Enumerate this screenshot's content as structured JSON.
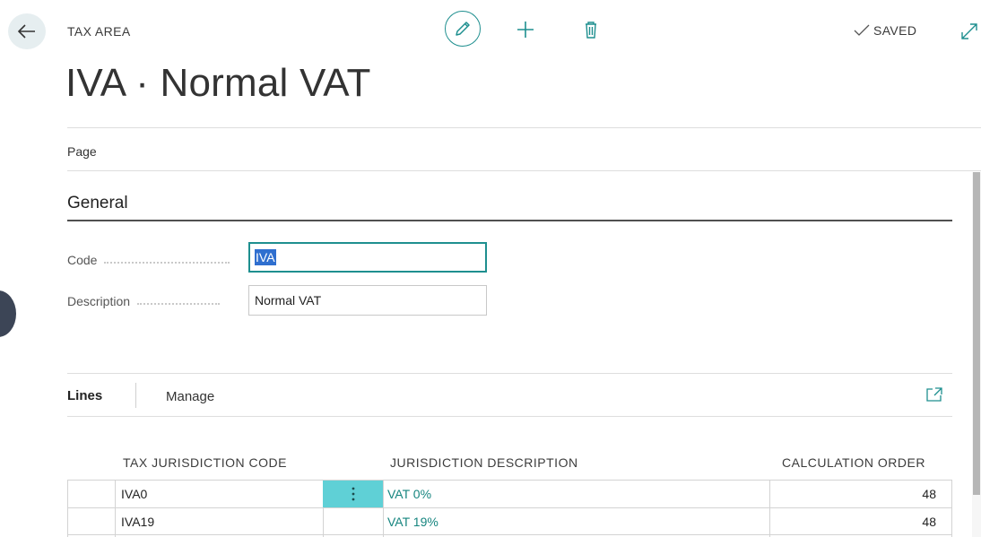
{
  "header": {
    "breadcrumb": "TAX AREA",
    "title": "IVA · Normal VAT",
    "status": "SAVED"
  },
  "action_bar": {
    "page_tab": "Page"
  },
  "general": {
    "title": "General",
    "fields": [
      {
        "label": "Code",
        "value": "IVA",
        "selected": true
      },
      {
        "label": "Description",
        "value": "Normal VAT"
      }
    ]
  },
  "lines": {
    "title": "Lines",
    "manage": "Manage",
    "columns": [
      "TAX JURISDICTION CODE",
      "JURISDICTION DESCRIPTION",
      "CALCULATION ORDER"
    ],
    "rows": [
      {
        "code": "IVA0",
        "description": "VAT 0%",
        "order": "48"
      },
      {
        "code": "IVA19",
        "description": "VAT 19%",
        "order": "48"
      }
    ]
  },
  "icons": {
    "back": "arrow-left-icon",
    "edit": "pencil-icon",
    "add": "plus-icon",
    "delete": "trash-icon",
    "saved": "checkmark-icon",
    "expand": "expand-icon",
    "row_menu": "vertical-dots-icon"
  },
  "colors": {
    "accent": "#1e8f8f",
    "link": "#16857f",
    "row_menu_bg": "#5fd0d6",
    "selection": "#2f6fcf"
  }
}
